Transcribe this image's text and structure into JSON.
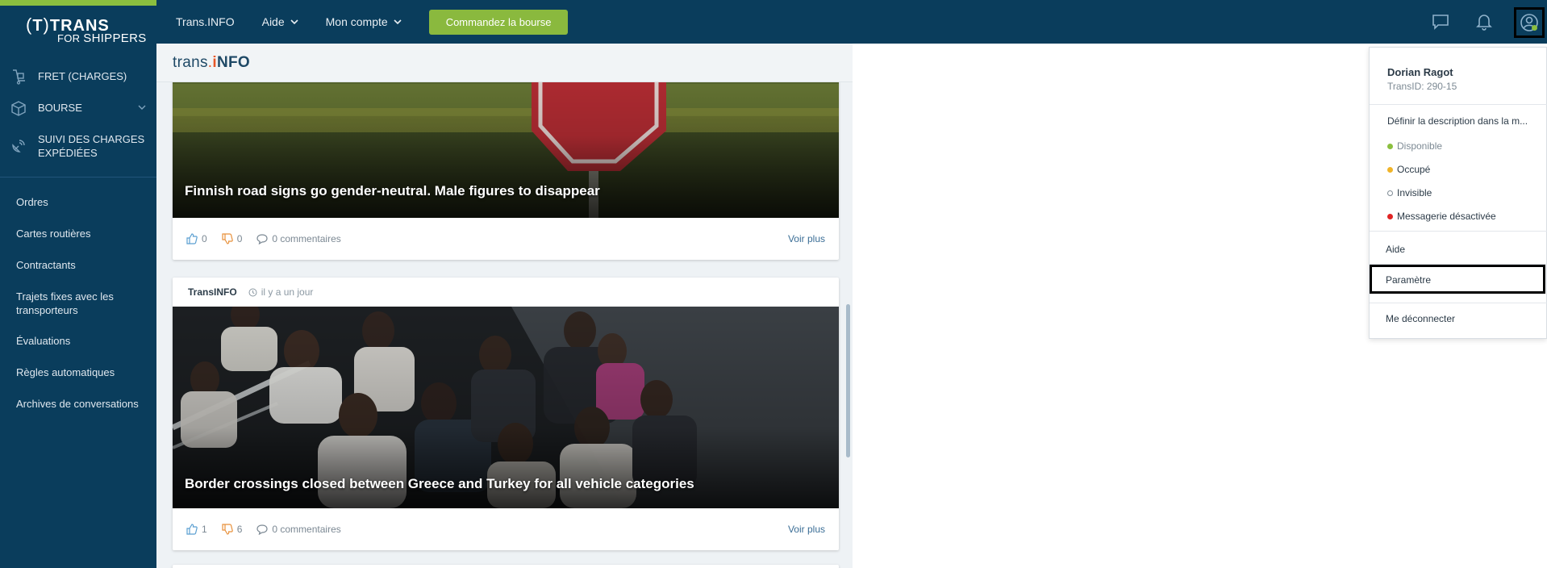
{
  "logo": {
    "mark": "TRANS",
    "paren_left": "(",
    "paren_letter": "T",
    "paren_right": ")",
    "sub_for": "FOR",
    "sub_shippers": "SHIPPERS"
  },
  "nav": {
    "transinfo": "Trans.INFO",
    "aide": "Aide",
    "account": "Mon compte",
    "cta": "Commandez la bourse"
  },
  "sidebar": {
    "main": [
      {
        "label": "FRET (CHARGES)",
        "icon": "trolley-icon"
      },
      {
        "label": "BOURSE",
        "icon": "box-icon"
      },
      {
        "label": "SUIVI DES CHARGES EXPÉDIÉES",
        "icon": "satellite-icon"
      }
    ],
    "sub": [
      "Ordres",
      "Cartes routières",
      "Contractants",
      "Trajets fixes avec les transporteurs",
      "Évaluations",
      "Règles automatiques",
      "Archives de conversations"
    ]
  },
  "feed": {
    "brand_left": "trans",
    "brand_dot": ".",
    "brand_i": "i",
    "brand_right": "NFO",
    "cards": [
      {
        "title": "Finnish road signs go gender-neutral. Male figures to disappear",
        "likes": "0",
        "dislikes": "0",
        "comments": "0 commentaires",
        "more": "Voir plus"
      },
      {
        "source": "TransINFO",
        "time": "il y a un jour",
        "title": "Border crossings closed between Greece and Turkey for all vehicle categories",
        "likes": "1",
        "dislikes": "6",
        "comments": "0 commentaires",
        "more": "Voir plus"
      }
    ]
  },
  "dropdown": {
    "name": "Dorian Ragot",
    "transid": "TransID: 290-15",
    "describe": "Définir la description dans la m...",
    "statuses": [
      {
        "label": "Disponible",
        "color": "#8bbf3f"
      },
      {
        "label": "Occupé",
        "color": "#f0b429"
      },
      {
        "label": "Invisible",
        "color": "#ffffff"
      },
      {
        "label": "Messagerie désactivée",
        "color": "#e02424"
      }
    ],
    "help": "Aide",
    "settings": "Paramètre",
    "logout": "Me déconnecter"
  },
  "colors": {
    "navy": "#0a3d5c",
    "green": "#8ab93e",
    "link": "#3b6e96"
  }
}
